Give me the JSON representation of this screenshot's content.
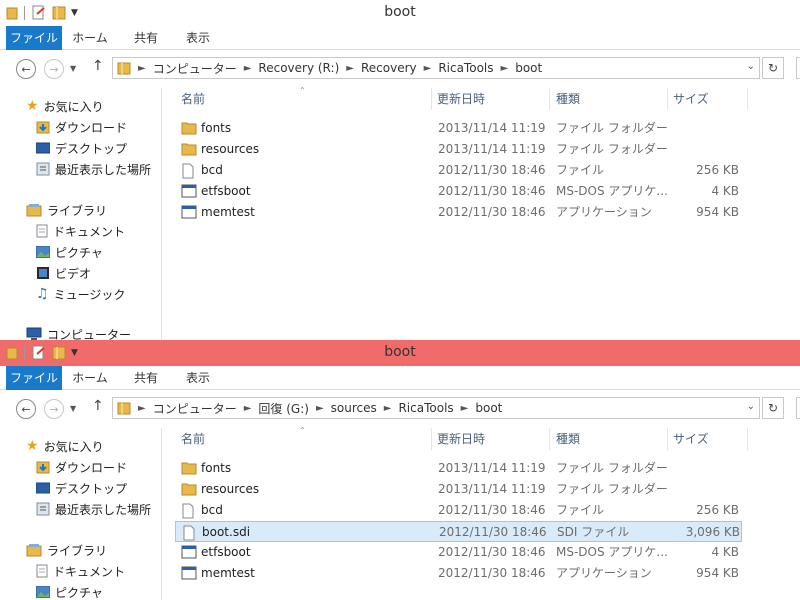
{
  "windows": [
    {
      "title": "boot",
      "ribbon": [
        "ファイル",
        "ホーム",
        "共有",
        "表示"
      ],
      "breadcrumb": [
        "コンピューター",
        "Recovery (R:)",
        "Recovery",
        "RicaTools",
        "boot"
      ],
      "sidebar": {
        "favorites": {
          "label": "お気に入り",
          "items": [
            "ダウンロード",
            "デスクトップ",
            "最近表示した場所"
          ]
        },
        "libraries": {
          "label": "ライブラリ",
          "items": [
            "ドキュメント",
            "ピクチャ",
            "ビデオ",
            "ミュージック"
          ]
        },
        "computer": {
          "label": "コンピューター"
        }
      },
      "columns": [
        "名前",
        "更新日時",
        "種類",
        "サイズ"
      ],
      "files": [
        {
          "name": "fonts",
          "date": "2013/11/14 11:19",
          "type": "ファイル フォルダー",
          "size": "",
          "icon": "folder-icon"
        },
        {
          "name": "resources",
          "date": "2013/11/14 11:19",
          "type": "ファイル フォルダー",
          "size": "",
          "icon": "folder-icon"
        },
        {
          "name": "bcd",
          "date": "2012/11/30 18:46",
          "type": "ファイル",
          "size": "256 KB",
          "icon": "file-icon"
        },
        {
          "name": "etfsboot",
          "date": "2012/11/30 18:46",
          "type": "MS-DOS アプリケ...",
          "size": "4 KB",
          "icon": "app-icon"
        },
        {
          "name": "memtest",
          "date": "2012/11/30 18:46",
          "type": "アプリケーション",
          "size": "954 KB",
          "icon": "app-icon"
        }
      ]
    },
    {
      "title": "boot",
      "ribbon": [
        "ファイル",
        "ホーム",
        "共有",
        "表示"
      ],
      "breadcrumb": [
        "コンピューター",
        "回復 (G:)",
        "sources",
        "RicaTools",
        "boot"
      ],
      "sidebar": {
        "favorites": {
          "label": "お気に入り",
          "items": [
            "ダウンロード",
            "デスクトップ",
            "最近表示した場所"
          ]
        },
        "libraries": {
          "label": "ライブラリ",
          "items": [
            "ドキュメント",
            "ピクチャ"
          ]
        }
      },
      "columns": [
        "名前",
        "更新日時",
        "種類",
        "サイズ"
      ],
      "files": [
        {
          "name": "fonts",
          "date": "2013/11/14 11:19",
          "type": "ファイル フォルダー",
          "size": "",
          "icon": "folder-icon"
        },
        {
          "name": "resources",
          "date": "2013/11/14 11:19",
          "type": "ファイル フォルダー",
          "size": "",
          "icon": "folder-icon"
        },
        {
          "name": "bcd",
          "date": "2012/11/30 18:46",
          "type": "ファイル",
          "size": "256 KB",
          "icon": "file-icon"
        },
        {
          "name": "boot.sdi",
          "date": "2012/11/30 18:46",
          "type": "SDI ファイル",
          "size": "3,096 KB",
          "icon": "file-icon",
          "selected": true
        },
        {
          "name": "etfsboot",
          "date": "2012/11/30 18:46",
          "type": "MS-DOS アプリケ...",
          "size": "4 KB",
          "icon": "app-icon"
        },
        {
          "name": "memtest",
          "date": "2012/11/30 18:46",
          "type": "アプリケーション",
          "size": "954 KB",
          "icon": "app-icon"
        }
      ]
    }
  ],
  "colors": {
    "file_tab": "#1979ca",
    "second_titlebar": "#f26b6b",
    "selection_fill": "#d9ebf9",
    "selection_border": "#99c9ef",
    "folder": "#e8b84a"
  }
}
